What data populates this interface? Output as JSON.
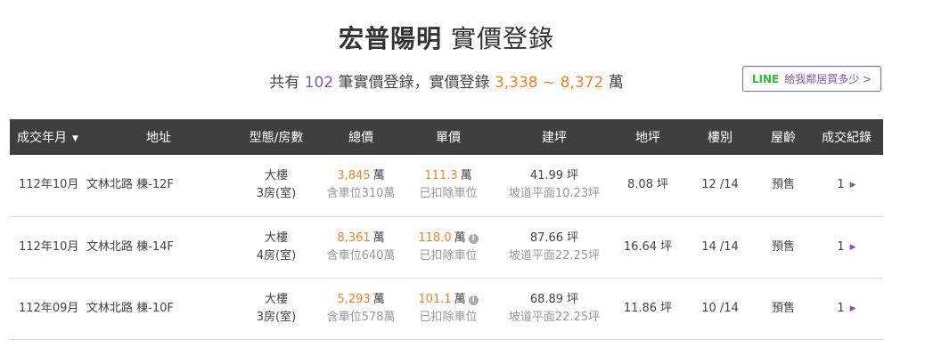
{
  "header": {
    "name": "宏普陽明",
    "subtitle": "實價登錄"
  },
  "summary": {
    "prefix": "共有",
    "count": "102",
    "mid": "筆實價登錄，實價登錄",
    "range": "3,338 ~ 8,372",
    "suffix": "萬"
  },
  "line_button": {
    "brand": "LINE",
    "label": "給我鄰居買多少 >"
  },
  "table": {
    "headers": {
      "date": "成交年月",
      "address": "地址",
      "type": "型態/房數",
      "total": "總價",
      "unit_price": "單價",
      "building_area": "建坪",
      "land_area": "地坪",
      "floor": "樓別",
      "age": "屋齡",
      "records": "成交紀錄"
    },
    "rows": [
      {
        "date": "112年10月",
        "address": "文林北路 棟-12F",
        "type": "大樓",
        "rooms": "3房(室)",
        "total": "3,845",
        "total_unit": "萬",
        "total_note": "含車位310萬",
        "unit_price": "111.3",
        "unit_price_unit": "萬",
        "unit_note": "已扣除車位",
        "has_info": false,
        "building_area": "41.99 坪",
        "building_note": "坡道平面10.23坪",
        "land_area": "8.08 坪",
        "floor": "12 /14",
        "age": "預售",
        "records": "1"
      },
      {
        "date": "112年10月",
        "address": "文林北路 棟-14F",
        "type": "大樓",
        "rooms": "4房(室)",
        "total": "8,361",
        "total_unit": "萬",
        "total_note": "含車位640萬",
        "unit_price": "118.0",
        "unit_price_unit": "萬",
        "unit_note": "已扣除車位",
        "has_info": true,
        "building_area": "87.66 坪",
        "building_note": "坡道平面22.25坪",
        "land_area": "16.64 坪",
        "floor": "14 /14",
        "age": "預售",
        "records": "1"
      },
      {
        "date": "112年09月",
        "address": "文林北路 棟-10F",
        "type": "大樓",
        "rooms": "3房(室)",
        "total": "5,293",
        "total_unit": "萬",
        "total_note": "含車位578萬",
        "unit_price": "101.1",
        "unit_price_unit": "萬",
        "unit_note": "已扣除車位",
        "has_info": true,
        "building_area": "68.89 坪",
        "building_note": "坡道平面22.25坪",
        "land_area": "11.86 坪",
        "floor": "10 /14",
        "age": "預售",
        "records": "1"
      }
    ]
  },
  "icons": {
    "sort": "caret-down-icon",
    "info": "info-icon",
    "more": "chevron-right-icon"
  },
  "colors": {
    "accent_purple": "#7c5aa6",
    "price_orange": "#e8862e",
    "line_green": "#2dbd3a",
    "header_bg": "#3f3f3f"
  }
}
